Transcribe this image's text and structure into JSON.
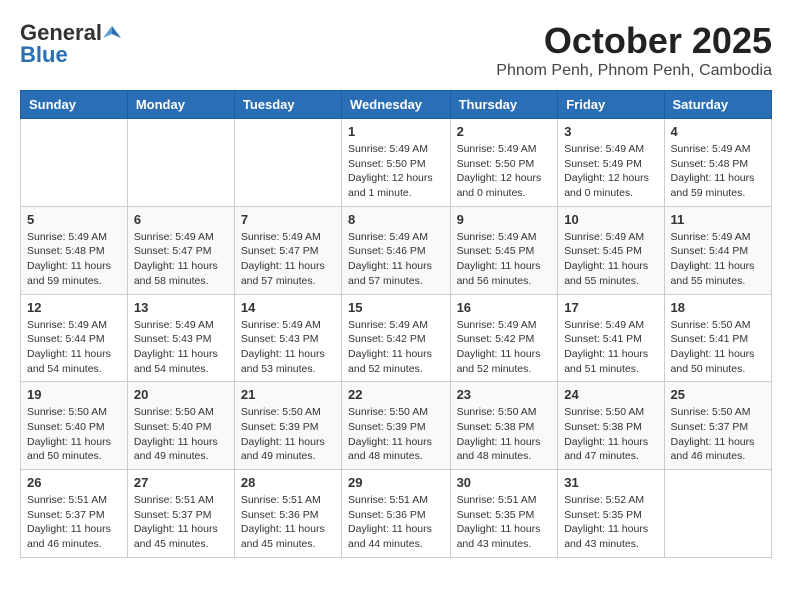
{
  "header": {
    "logo_general": "General",
    "logo_blue": "Blue",
    "month": "October 2025",
    "location": "Phnom Penh, Phnom Penh, Cambodia"
  },
  "weekdays": [
    "Sunday",
    "Monday",
    "Tuesday",
    "Wednesday",
    "Thursday",
    "Friday",
    "Saturday"
  ],
  "weeks": [
    [
      {
        "day": "",
        "info": ""
      },
      {
        "day": "",
        "info": ""
      },
      {
        "day": "",
        "info": ""
      },
      {
        "day": "1",
        "info": "Sunrise: 5:49 AM\nSunset: 5:50 PM\nDaylight: 12 hours\nand 1 minute."
      },
      {
        "day": "2",
        "info": "Sunrise: 5:49 AM\nSunset: 5:50 PM\nDaylight: 12 hours\nand 0 minutes."
      },
      {
        "day": "3",
        "info": "Sunrise: 5:49 AM\nSunset: 5:49 PM\nDaylight: 12 hours\nand 0 minutes."
      },
      {
        "day": "4",
        "info": "Sunrise: 5:49 AM\nSunset: 5:48 PM\nDaylight: 11 hours\nand 59 minutes."
      }
    ],
    [
      {
        "day": "5",
        "info": "Sunrise: 5:49 AM\nSunset: 5:48 PM\nDaylight: 11 hours\nand 59 minutes."
      },
      {
        "day": "6",
        "info": "Sunrise: 5:49 AM\nSunset: 5:47 PM\nDaylight: 11 hours\nand 58 minutes."
      },
      {
        "day": "7",
        "info": "Sunrise: 5:49 AM\nSunset: 5:47 PM\nDaylight: 11 hours\nand 57 minutes."
      },
      {
        "day": "8",
        "info": "Sunrise: 5:49 AM\nSunset: 5:46 PM\nDaylight: 11 hours\nand 57 minutes."
      },
      {
        "day": "9",
        "info": "Sunrise: 5:49 AM\nSunset: 5:45 PM\nDaylight: 11 hours\nand 56 minutes."
      },
      {
        "day": "10",
        "info": "Sunrise: 5:49 AM\nSunset: 5:45 PM\nDaylight: 11 hours\nand 55 minutes."
      },
      {
        "day": "11",
        "info": "Sunrise: 5:49 AM\nSunset: 5:44 PM\nDaylight: 11 hours\nand 55 minutes."
      }
    ],
    [
      {
        "day": "12",
        "info": "Sunrise: 5:49 AM\nSunset: 5:44 PM\nDaylight: 11 hours\nand 54 minutes."
      },
      {
        "day": "13",
        "info": "Sunrise: 5:49 AM\nSunset: 5:43 PM\nDaylight: 11 hours\nand 54 minutes."
      },
      {
        "day": "14",
        "info": "Sunrise: 5:49 AM\nSunset: 5:43 PM\nDaylight: 11 hours\nand 53 minutes."
      },
      {
        "day": "15",
        "info": "Sunrise: 5:49 AM\nSunset: 5:42 PM\nDaylight: 11 hours\nand 52 minutes."
      },
      {
        "day": "16",
        "info": "Sunrise: 5:49 AM\nSunset: 5:42 PM\nDaylight: 11 hours\nand 52 minutes."
      },
      {
        "day": "17",
        "info": "Sunrise: 5:49 AM\nSunset: 5:41 PM\nDaylight: 11 hours\nand 51 minutes."
      },
      {
        "day": "18",
        "info": "Sunrise: 5:50 AM\nSunset: 5:41 PM\nDaylight: 11 hours\nand 50 minutes."
      }
    ],
    [
      {
        "day": "19",
        "info": "Sunrise: 5:50 AM\nSunset: 5:40 PM\nDaylight: 11 hours\nand 50 minutes."
      },
      {
        "day": "20",
        "info": "Sunrise: 5:50 AM\nSunset: 5:40 PM\nDaylight: 11 hours\nand 49 minutes."
      },
      {
        "day": "21",
        "info": "Sunrise: 5:50 AM\nSunset: 5:39 PM\nDaylight: 11 hours\nand 49 minutes."
      },
      {
        "day": "22",
        "info": "Sunrise: 5:50 AM\nSunset: 5:39 PM\nDaylight: 11 hours\nand 48 minutes."
      },
      {
        "day": "23",
        "info": "Sunrise: 5:50 AM\nSunset: 5:38 PM\nDaylight: 11 hours\nand 48 minutes."
      },
      {
        "day": "24",
        "info": "Sunrise: 5:50 AM\nSunset: 5:38 PM\nDaylight: 11 hours\nand 47 minutes."
      },
      {
        "day": "25",
        "info": "Sunrise: 5:50 AM\nSunset: 5:37 PM\nDaylight: 11 hours\nand 46 minutes."
      }
    ],
    [
      {
        "day": "26",
        "info": "Sunrise: 5:51 AM\nSunset: 5:37 PM\nDaylight: 11 hours\nand 46 minutes."
      },
      {
        "day": "27",
        "info": "Sunrise: 5:51 AM\nSunset: 5:37 PM\nDaylight: 11 hours\nand 45 minutes."
      },
      {
        "day": "28",
        "info": "Sunrise: 5:51 AM\nSunset: 5:36 PM\nDaylight: 11 hours\nand 45 minutes."
      },
      {
        "day": "29",
        "info": "Sunrise: 5:51 AM\nSunset: 5:36 PM\nDaylight: 11 hours\nand 44 minutes."
      },
      {
        "day": "30",
        "info": "Sunrise: 5:51 AM\nSunset: 5:35 PM\nDaylight: 11 hours\nand 43 minutes."
      },
      {
        "day": "31",
        "info": "Sunrise: 5:52 AM\nSunset: 5:35 PM\nDaylight: 11 hours\nand 43 minutes."
      },
      {
        "day": "",
        "info": ""
      }
    ]
  ]
}
